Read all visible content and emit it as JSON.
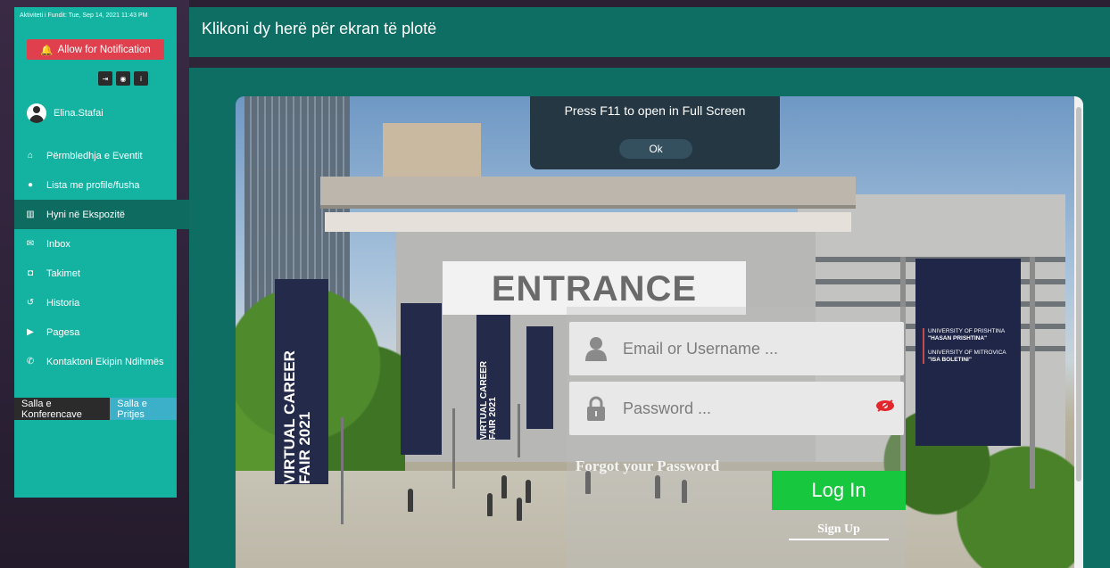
{
  "sidebar": {
    "activity": "Aktiviteti i Fundit: Tue, Sep 14, 2021 11:43 PM",
    "notification_button": "Allow for Notification",
    "icons": [
      "sign-out-icon",
      "globe-icon",
      "info-icon"
    ],
    "username": "Elina.Stafai",
    "menu": [
      {
        "label": "Përmbledhja e Eventit",
        "icon": "home-icon"
      },
      {
        "label": "Lista me profile/fusha",
        "icon": "user-icon"
      },
      {
        "label": "Hyni në Ekspozitë",
        "icon": "building-icon",
        "active": true
      },
      {
        "label": "Inbox",
        "icon": "envelope-icon"
      },
      {
        "label": "Takimet",
        "icon": "camera-icon"
      },
      {
        "label": "Historia",
        "icon": "history-icon"
      },
      {
        "label": "Pagesa",
        "icon": "credit-icon"
      },
      {
        "label": "Kontaktoni Ekipin Ndihmës",
        "icon": "phone-icon"
      }
    ],
    "hall_tabs": [
      "Salla e Konferencave",
      "Salla e Pritjes"
    ]
  },
  "header": {
    "title": "Klikoni dy herë për ekran të plotë"
  },
  "scene": {
    "popup_message": "Press F11 to open in Full Screen",
    "popup_ok": "Ok",
    "entrance_sign": "ENTRANCE",
    "banner_text": "VIRTUAL CAREER FAIR 2021",
    "uni1_line1": "UNIVERSITY OF PRISHTINA",
    "uni1_line2": "\"HASAN PRISHTINA\"",
    "uni2_line1": "UNIVERSITY OF MITROVICA",
    "uni2_line2": "\"ISA BOLETINI\"",
    "email_placeholder": "Email or Username ...",
    "password_placeholder": "Password ...",
    "forgot": "Forgot your Password",
    "login": "Log In",
    "signup": "Sign Up"
  },
  "colors": {
    "sidebar": "#14b3a1",
    "header": "#0f6e63",
    "notification": "#e0404e",
    "login": "#17c73e"
  }
}
